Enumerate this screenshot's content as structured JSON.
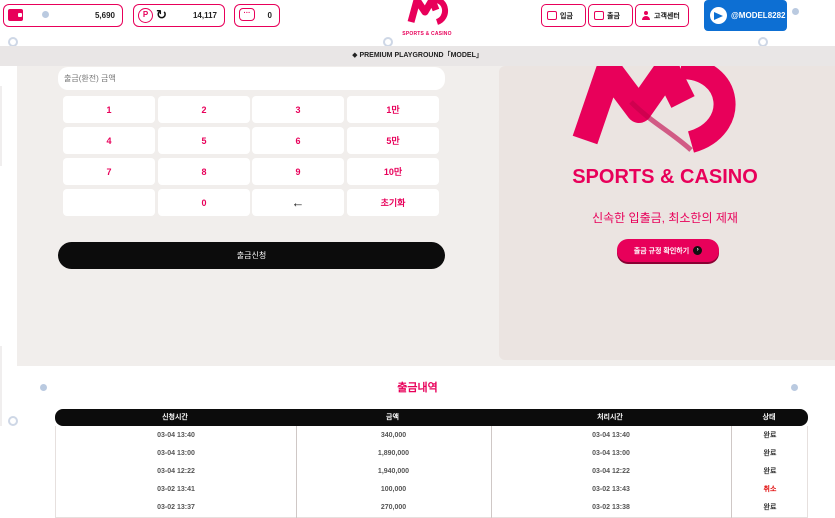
{
  "header": {
    "balance": "5,690",
    "point": "14,117",
    "messages": "0",
    "logo_sub": "SPORTS & CASINO",
    "nav": [
      {
        "label": "입금"
      },
      {
        "label": "출금"
      },
      {
        "label": "고객센터"
      }
    ],
    "telegram": "@MODEL8282"
  },
  "notice": "◆ PREMIUM PLAYGROUND「MODEL」",
  "withdraw": {
    "placeholder": "출금(환전) 금액",
    "keys": [
      "1",
      "2",
      "3",
      "1만",
      "4",
      "5",
      "6",
      "5만",
      "7",
      "8",
      "9",
      "10만",
      "",
      "0",
      "←",
      "초기화"
    ],
    "submit_label": "출금신청"
  },
  "promo": {
    "brand": "SPORTS & CASINO",
    "slogan": "신속한 입출금, 최소한의 제재",
    "rule_button": "출금 규정 확인하기",
    "rule_chevron": "›"
  },
  "history": {
    "title": "출금내역",
    "columns": [
      "신청시간",
      "금액",
      "처리시간",
      "상태"
    ],
    "rows": [
      {
        "requested": "03-04 13:40",
        "amount": "340,000",
        "processed": "03-04 13:40",
        "status": "완료"
      },
      {
        "requested": "03-04 13:00",
        "amount": "1,890,000",
        "processed": "03-04 13:00",
        "status": "완료"
      },
      {
        "requested": "03-04 12:22",
        "amount": "1,940,000",
        "processed": "03-04 12:22",
        "status": "완료"
      },
      {
        "requested": "03-02 13:41",
        "amount": "100,000",
        "processed": "03-02 13:43",
        "status": "취소"
      },
      {
        "requested": "03-02 13:37",
        "amount": "270,000",
        "processed": "03-02 13:38",
        "status": "완료"
      }
    ]
  },
  "colors": {
    "accent": "#e8005a",
    "dark": "#0c0c0c",
    "panel": "#f1eeec",
    "telegram": "#0d6fd3",
    "cancel": "#e00000"
  },
  "icons": [
    "wallet-icon",
    "coin-icon",
    "point-icon",
    "refresh-icon",
    "message-icon",
    "deposit-icon",
    "withdraw-icon",
    "support-icon",
    "telegram-icon",
    "chevron-right-icon",
    "backspace-icon"
  ]
}
